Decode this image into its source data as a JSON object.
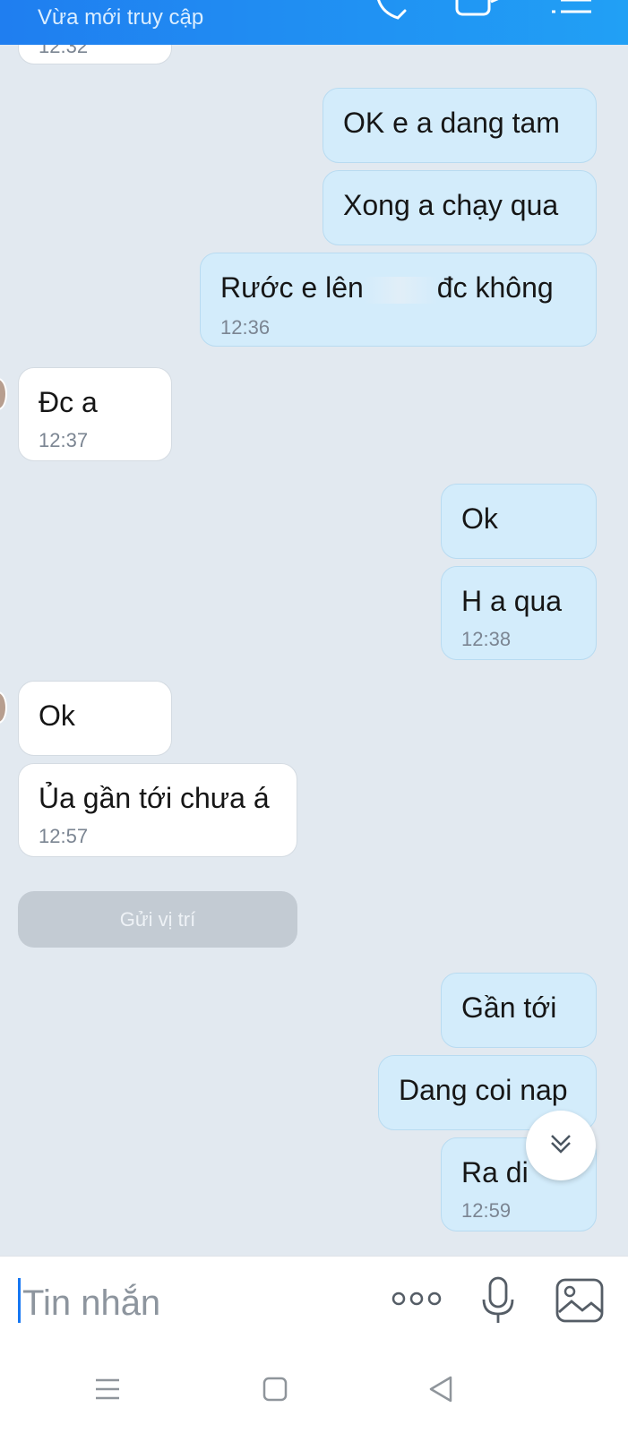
{
  "header": {
    "status": "Vừa mới truy cập",
    "icons": [
      "phone-icon",
      "video-call-icon",
      "menu-icon"
    ]
  },
  "messages": [
    {
      "dir": "in",
      "time": "12:32"
    },
    {
      "dir": "out",
      "text": "OK e a dang tam"
    },
    {
      "dir": "out",
      "text": "Xong a chạy qua"
    },
    {
      "dir": "out",
      "text_a": "Rước e lên",
      "text_b": "đc không",
      "time": "12:36"
    },
    {
      "dir": "in",
      "text": "Đc a",
      "time": "12:37"
    },
    {
      "dir": "out",
      "text": "Ok"
    },
    {
      "dir": "out",
      "text": "H a qua",
      "time": "12:38"
    },
    {
      "dir": "in",
      "text": "Ok"
    },
    {
      "dir": "in",
      "text": "Ủa gần tới chưa á",
      "time": "12:57"
    },
    {
      "dir": "out",
      "text": "Gần tới"
    },
    {
      "dir": "out",
      "text": "Dang coi nap"
    },
    {
      "dir": "out",
      "text": "Ra di",
      "time": "12:59"
    }
  ],
  "location_button": "Gửi vị trí",
  "composer": {
    "placeholder": "Tin nhắn",
    "icons": [
      "more-options-icon",
      "microphone-icon",
      "image-icon"
    ]
  },
  "navbar": {
    "icons": [
      "recent-apps-icon",
      "home-icon",
      "back-icon"
    ]
  },
  "colors": {
    "header_start": "#1f7ef0",
    "header_end": "#21a0f5",
    "outgoing_bubble": "#d3ecfb",
    "incoming_bubble": "#ffffff",
    "chat_background": "#e2e9f0",
    "caret": "#1677f2"
  }
}
